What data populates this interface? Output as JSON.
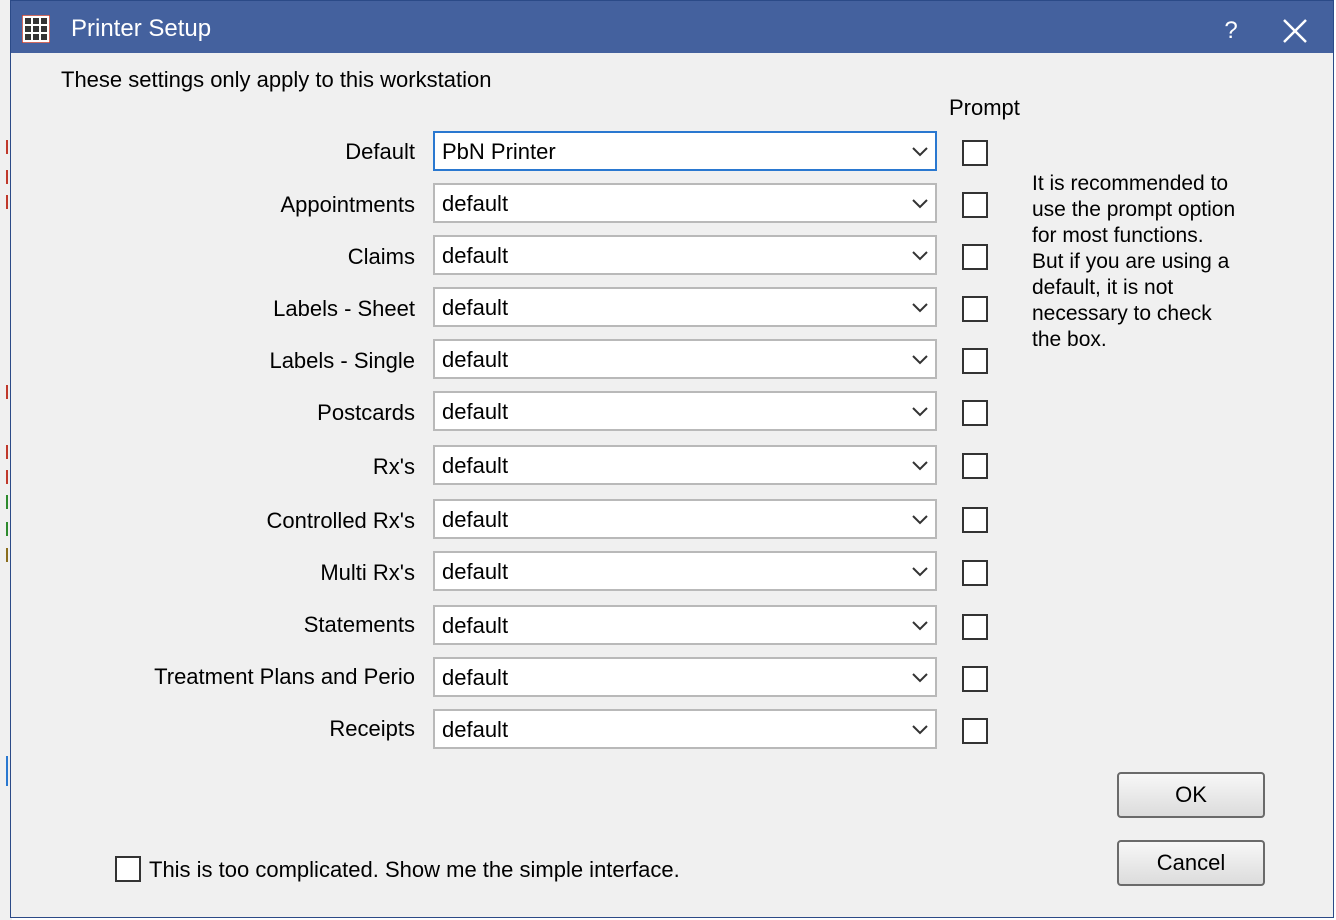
{
  "window": {
    "title": "Printer Setup",
    "help_label": "?",
    "titlebar_color": "#44619e"
  },
  "notice": "These settings only apply to this workstation",
  "prompt_header": "Prompt",
  "rows": [
    {
      "label": "Default",
      "value": "PbN Printer",
      "prompt": false
    },
    {
      "label": "Appointments",
      "value": "default",
      "prompt": false
    },
    {
      "label": "Claims",
      "value": "default",
      "prompt": false
    },
    {
      "label": "Labels - Sheet",
      "value": "default",
      "prompt": false
    },
    {
      "label": "Labels - Single",
      "value": "default",
      "prompt": false
    },
    {
      "label": "Postcards",
      "value": "default",
      "prompt": false
    },
    {
      "label": "Rx's",
      "value": "default",
      "prompt": false
    },
    {
      "label": "Controlled Rx's",
      "value": "default",
      "prompt": false
    },
    {
      "label": "Multi Rx's",
      "value": "default",
      "prompt": false
    },
    {
      "label": "Statements",
      "value": "default",
      "prompt": false
    },
    {
      "label": "Treatment Plans and Perio",
      "value": "default",
      "prompt": false
    },
    {
      "label": "Receipts",
      "value": "default",
      "prompt": false
    }
  ],
  "info_lines": [
    "It is recommended to",
    "use the prompt option",
    "for most functions.",
    "But if you are using a",
    "default, it is not",
    "necessary to check",
    "the box."
  ],
  "ok_label": "OK",
  "cancel_label": "Cancel",
  "simple_interface_label": "This is too complicated.  Show me the simple interface.",
  "simple_interface_checked": false
}
